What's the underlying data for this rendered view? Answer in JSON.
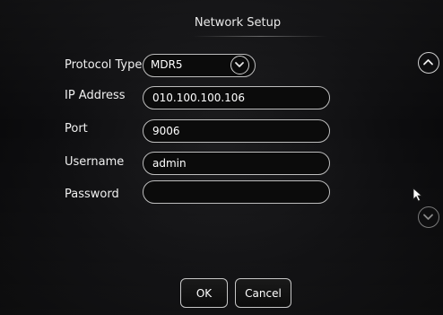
{
  "dialog": {
    "title": "Network Setup"
  },
  "fields": {
    "protocol_type": {
      "label": "Protocol Type",
      "value": "MDR5"
    },
    "ip_address": {
      "label": "IP Address",
      "value": "010.100.100.106"
    },
    "port": {
      "label": "Port",
      "value": "9006"
    },
    "username": {
      "label": "Username",
      "value": "admin"
    },
    "password": {
      "label": "Password",
      "value": ""
    }
  },
  "buttons": {
    "ok": "OK",
    "cancel": "Cancel"
  },
  "icons": {
    "dropdown": "chevron-down-icon",
    "scroll_up": "chevron-up-icon",
    "scroll_down": "chevron-down-icon",
    "cursor": "mouse-pointer-icon"
  }
}
